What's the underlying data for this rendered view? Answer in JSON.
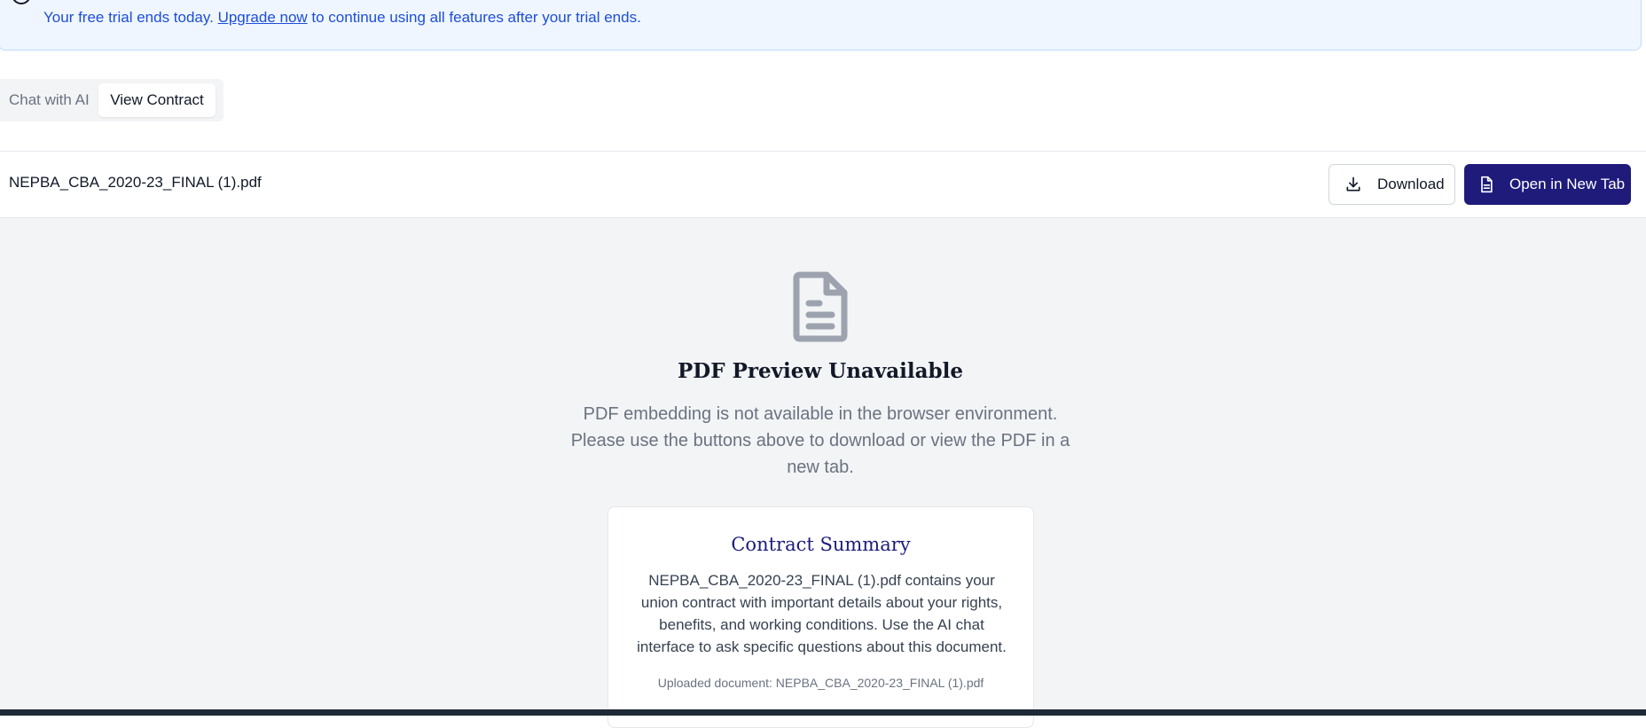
{
  "banner": {
    "text_before": "Your free trial ends today. ",
    "link": "Upgrade now",
    "text_after": " to continue using all features after your trial ends."
  },
  "tabs": [
    {
      "label": "Chat with AI",
      "active": false
    },
    {
      "label": "View Contract",
      "active": true
    }
  ],
  "viewer": {
    "file_name": "NEPBA_CBA_2020-23_FINAL (1).pdf",
    "download_label": "Download",
    "open_label": "Open in New Tab"
  },
  "preview": {
    "icon": "document-icon",
    "title": "PDF Preview Unavailable",
    "description": "PDF embedding is not available in the browser environment. Please use the buttons above to download or view the PDF in a new tab."
  },
  "summary": {
    "title": "Contract Summary",
    "body": "NEPBA_CBA_2020-23_FINAL (1).pdf contains your union contract with important details about your rights, benefits, and working conditions. Use the AI chat interface to ask specific questions about this document.",
    "uploaded": "Uploaded document: NEPBA_CBA_2020-23_FINAL (1).pdf"
  },
  "colors": {
    "accent": "#1e1b7b",
    "banner_bg": "#eff6ff",
    "banner_text": "#1d4ed8",
    "preview_bg": "#f3f4f6"
  }
}
